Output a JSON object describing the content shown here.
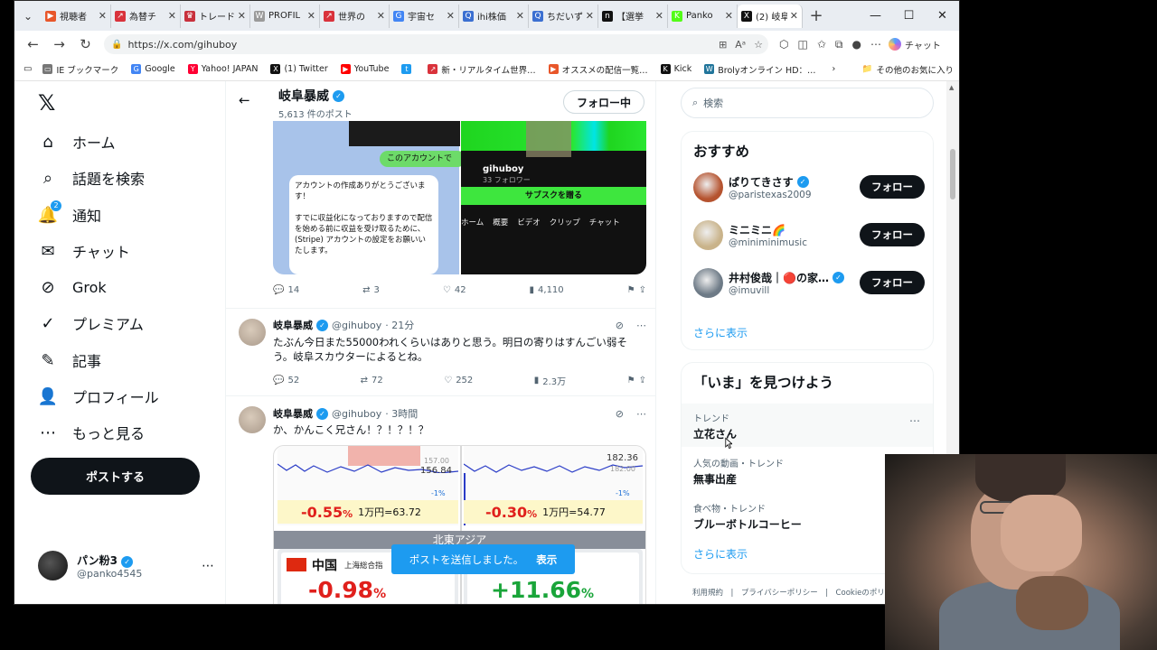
{
  "browser": {
    "tabs": [
      {
        "label": "視聴者",
        "color": "#e8562a",
        "glyph": "▶"
      },
      {
        "label": "為替チ",
        "color": "#d9323b",
        "glyph": "↗"
      },
      {
        "label": "トレード",
        "color": "#c8303c",
        "glyph": "♛"
      },
      {
        "label": "PROFIL",
        "color": "#9a9a9a",
        "glyph": "W"
      },
      {
        "label": "世界の",
        "color": "#d9323b",
        "glyph": "↗"
      },
      {
        "label": "宇宙セ",
        "color": "#4285f4",
        "glyph": "G"
      },
      {
        "label": "ihi株価",
        "color": "#3b6fd1",
        "glyph": "Q"
      },
      {
        "label": "ちだいず",
        "color": "#3b6fd1",
        "glyph": "Q"
      },
      {
        "label": "【選挙",
        "color": "#111111",
        "glyph": "n"
      },
      {
        "label": "Panko",
        "color": "#53fc18",
        "glyph": "K"
      },
      {
        "label": "(2) 岐阜",
        "color": "#111111",
        "glyph": "X",
        "active": true
      }
    ],
    "url": "https://x.com/gihuboy",
    "chat_label": "チャット",
    "bookmarks": [
      {
        "label": "IE ブックマーク",
        "color": "#777777",
        "glyph": "▭"
      },
      {
        "label": "Google",
        "color": "#4285f4",
        "glyph": "G"
      },
      {
        "label": "Yahoo! JAPAN",
        "color": "#ff0033",
        "glyph": "Y"
      },
      {
        "label": "(1) Twitter",
        "color": "#111111",
        "glyph": "X"
      },
      {
        "label": "YouTube",
        "color": "#ff0000",
        "glyph": "▶"
      },
      {
        "label": "",
        "color": "#1d9bf0",
        "glyph": "t"
      },
      {
        "label": "新・リアルタイム世界…",
        "color": "#d9323b",
        "glyph": "↗"
      },
      {
        "label": "オススメの配信一覧…",
        "color": "#e8562a",
        "glyph": "▶"
      },
      {
        "label": "Kick",
        "color": "#111111",
        "glyph": "K"
      },
      {
        "label": "Brolyオンライン HD：…",
        "color": "#21759b",
        "glyph": "W"
      }
    ],
    "bookmarks_more": "その他のお気に入り"
  },
  "leftnav": {
    "items": [
      {
        "label": "ホーム",
        "icon": "home-icon",
        "glyph": "⌂"
      },
      {
        "label": "話題を検索",
        "icon": "search-icon",
        "glyph": "⌕"
      },
      {
        "label": "通知",
        "icon": "bell-icon",
        "glyph": "🔔",
        "badge": "2"
      },
      {
        "label": "チャット",
        "icon": "mail-icon",
        "glyph": "✉"
      },
      {
        "label": "Grok",
        "icon": "grok-icon",
        "glyph": "⊘"
      },
      {
        "label": "プレミアム",
        "icon": "verified-icon",
        "glyph": "✓"
      },
      {
        "label": "記事",
        "icon": "article-icon",
        "glyph": "✎"
      },
      {
        "label": "プロフィール",
        "icon": "person-icon",
        "glyph": "👤"
      },
      {
        "label": "もっと見る",
        "icon": "more-circle-icon",
        "glyph": "⋯"
      }
    ],
    "post_button": "ポストする",
    "account": {
      "name": "パン粉3",
      "handle": "@panko4545"
    }
  },
  "profile_header": {
    "name": "岐阜暴威",
    "post_count": "5,613 件のポスト",
    "follow_label": "フォロー中"
  },
  "tweet1": {
    "media": {
      "green_bubble": "このアカウントで",
      "message": "アカウントの作成ありがとうございます！\n\nすでに収益化になっておりますので配信を始める前に収益を受け取るために、(Stripe) アカウントの設定をお願いいたします。",
      "handle": "gihuboy",
      "followers": "33 フォロワー",
      "subscribe": "サブスクを贈る",
      "tabs": [
        "ホーム",
        "概要",
        "ビデオ",
        "クリップ",
        "チャット"
      ]
    },
    "replies": "14",
    "retweets": "3",
    "likes": "42",
    "views": "4,110"
  },
  "tweet2": {
    "name": "岐阜暴威",
    "handle": "@gihuboy",
    "time": "· 21分",
    "text": "たぶん今日また55000われくらいはありと思う。明日の寄りはすんごい弱そう。岐阜スカウターによるとね。",
    "replies": "52",
    "retweets": "72",
    "likes": "252",
    "views": "2.3万"
  },
  "tweet3": {
    "name": "岐阜暴威",
    "handle": "@gihuboy",
    "time": "· 3時間",
    "text": "か、かんこく兄さん！？！？！？",
    "media": {
      "left_price": "156.84",
      "left_price_top": "157.00",
      "right_price": "182.36",
      "right_price_low": "182.00",
      "pct_left": "-1%",
      "pct_right": "-1%",
      "left_change": "-0.55",
      "left_yen": "1万円=63.72",
      "right_change": "-0.30",
      "right_yen": "1万円=54.77",
      "region": "北東アジア",
      "country": "中国",
      "index_name": "上海総合指",
      "cn_change": "-0.98",
      "kr_change": "+11.66",
      "pct_unit": "%"
    }
  },
  "toast": {
    "message": "ポストを送信しました。",
    "action": "表示"
  },
  "sidebar": {
    "search_placeholder": "検索",
    "recommend_title": "おすすめ",
    "recommendations": [
      {
        "name": "ぱりてきさす",
        "handle": "@paristexas2009",
        "follow": "フォロー",
        "verified": true,
        "avatar": "#b5532f"
      },
      {
        "name": "ミニミニ🌈",
        "handle": "@miniminimusic",
        "follow": "フォロー",
        "verified": false,
        "avatar": "#c9b38a"
      },
      {
        "name": "井村俊哉｜🔴の家…",
        "handle": "@imuvill",
        "follow": "フォロー",
        "verified": true,
        "avatar": "#6d7a86"
      }
    ],
    "show_more": "さらに表示",
    "trends_title": "「いま」を見つけよう",
    "trends": [
      {
        "meta": "トレンド",
        "name": "立花さん"
      },
      {
        "meta": "人気の動画・トレンド",
        "name": "無事出産"
      },
      {
        "meta": "食べ物・トレンド",
        "name": "ブルーボトルコーヒー"
      }
    ],
    "trends_more": "さらに表示",
    "footer": "利用規約　|　プライバシーポリシー　|　Cookieのポリ"
  }
}
